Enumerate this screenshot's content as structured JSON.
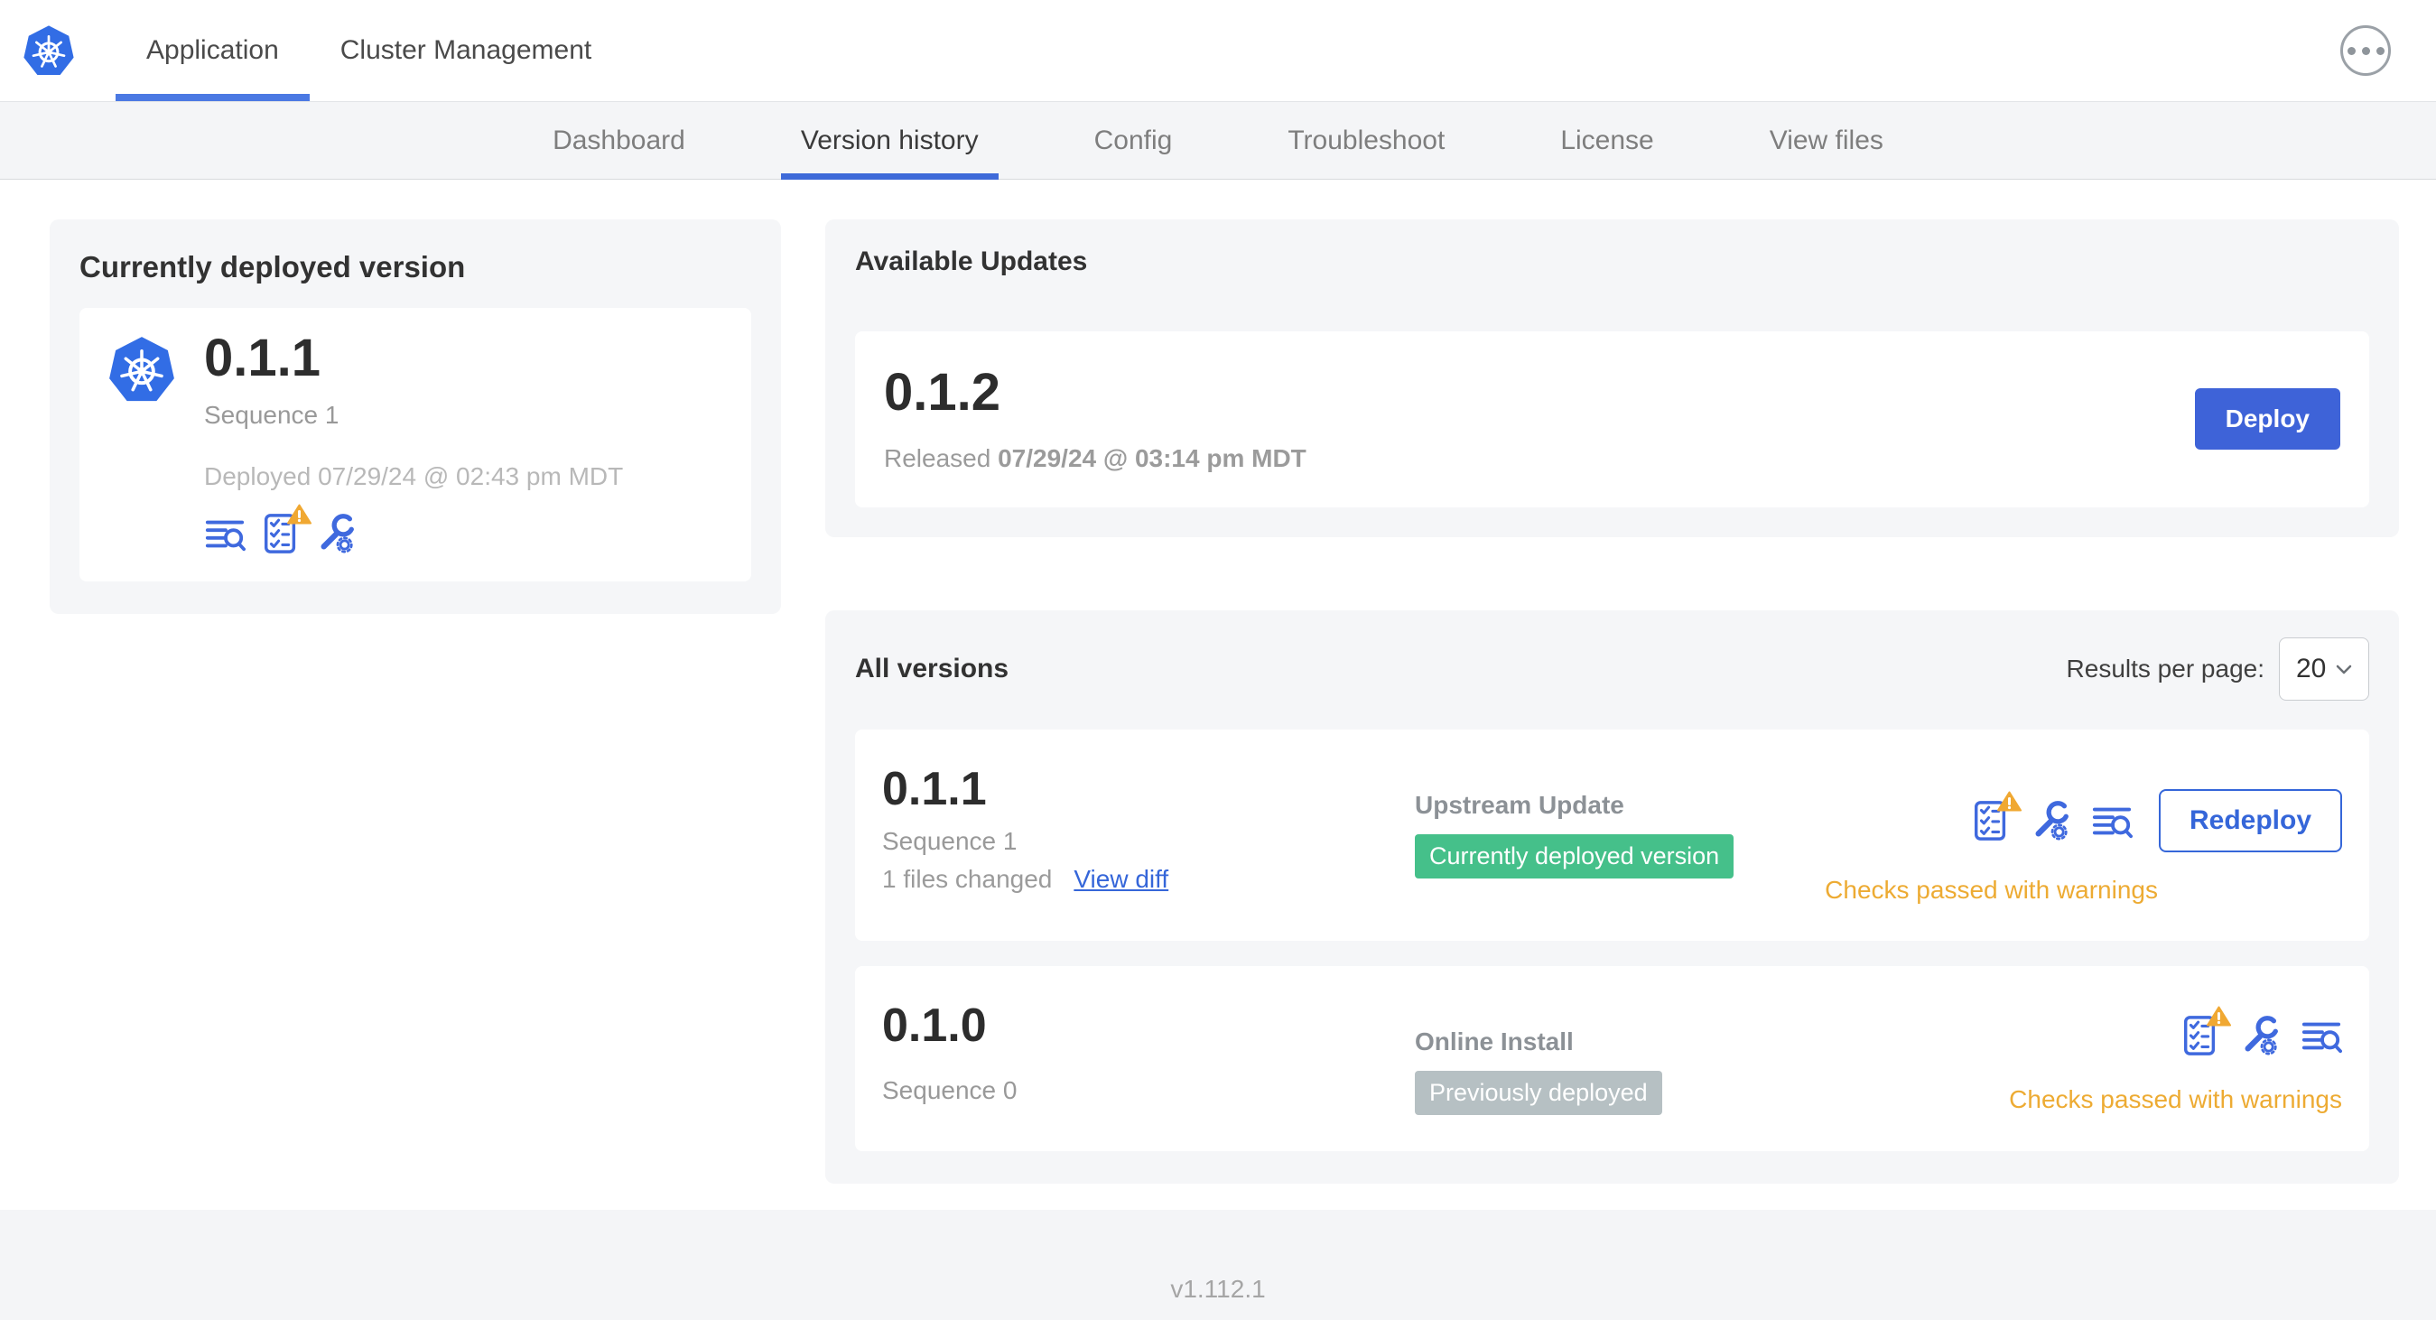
{
  "header": {
    "tabs": [
      {
        "label": "Application",
        "active": true
      },
      {
        "label": "Cluster Management",
        "active": false
      }
    ]
  },
  "subnav": {
    "tabs": [
      "Dashboard",
      "Version history",
      "Config",
      "Troubleshoot",
      "License",
      "View files"
    ],
    "active": "Version history"
  },
  "current_version_card": {
    "title": "Currently deployed version",
    "version": "0.1.1",
    "sequence": "Sequence 1",
    "deployed_label": "Deployed 07/29/24 @ 02:43 pm MDT"
  },
  "available_updates": {
    "title": "Available Updates",
    "version": "0.1.2",
    "released_prefix": "Released ",
    "released_date": "07/29/24 @ 03:14 pm MDT",
    "deploy_label": "Deploy"
  },
  "all_versions": {
    "title": "All versions",
    "results_per_page_label": "Results per page:",
    "results_per_page_value": "20",
    "rows": [
      {
        "version": "0.1.1",
        "sequence": "Sequence 1",
        "files_changed": "1 files changed",
        "view_diff_label": "View diff",
        "source": "Upstream Update",
        "badge": "Currently deployed version",
        "badge_color": "green",
        "action_label": "Redeploy",
        "status": "Checks passed with warnings"
      },
      {
        "version": "0.1.0",
        "sequence": "Sequence 0",
        "source": "Online Install",
        "badge": "Previously deployed",
        "badge_color": "gray",
        "status": "Checks passed with warnings"
      }
    ]
  },
  "footer": {
    "version": "v1.112.1"
  },
  "icons": {
    "logo-icon": "kubernetes-helm-wheel",
    "more-icon": "ellipsis-in-circle",
    "logs-icon": "lines-with-magnifier",
    "preflight-checks-icon": "checklist",
    "warning-icon": "amber-triangle-exclamation",
    "config-icon": "wrench-with-gear",
    "chevron-down-icon": "chevron-down"
  },
  "colors": {
    "accent_blue": "#3566d9",
    "deploy_button_blue": "#3e63d8",
    "kubernetes_blue": "#326de5",
    "badge_green": "#45c08a",
    "badge_gray": "#b6c0c3",
    "warning_amber": "#edab33",
    "card_gray": "#f5f6f8"
  }
}
